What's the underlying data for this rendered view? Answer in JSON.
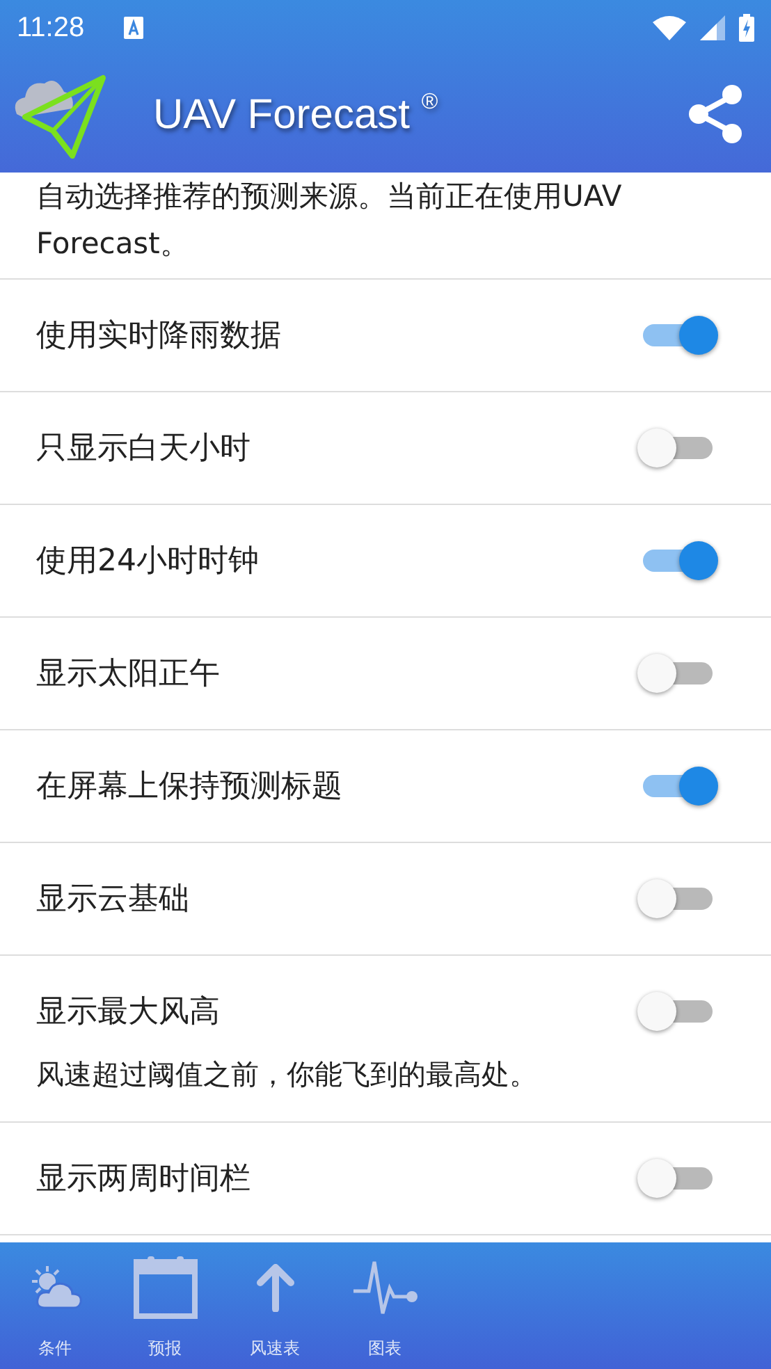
{
  "status_bar": {
    "time": "11:28"
  },
  "app_bar": {
    "title": "UAV Forecast",
    "mark": "®"
  },
  "intro": {
    "text": "自动选择推荐的预测来源。当前正在使用UAV Forecast。"
  },
  "settings": [
    {
      "label": "使用实时降雨数据",
      "on": true
    },
    {
      "label": "只显示白天小时",
      "on": false
    },
    {
      "label": "使用24小时时钟",
      "on": true
    },
    {
      "label": "显示太阳正午",
      "on": false
    },
    {
      "label": "在屏幕上保持预测标题",
      "on": true
    },
    {
      "label": "显示云基础",
      "on": false
    },
    {
      "label": "显示最大风高",
      "on": false,
      "description": "风速超过阈值之前，你能飞到的最高处。"
    },
    {
      "label": "显示两周时间栏",
      "on": false
    }
  ],
  "bottom_nav": [
    {
      "kind": "weather",
      "label": "条件"
    },
    {
      "kind": "calendar",
      "label": "预报"
    },
    {
      "kind": "arrow",
      "label": "风速表"
    },
    {
      "kind": "chart",
      "label": "图表"
    }
  ]
}
